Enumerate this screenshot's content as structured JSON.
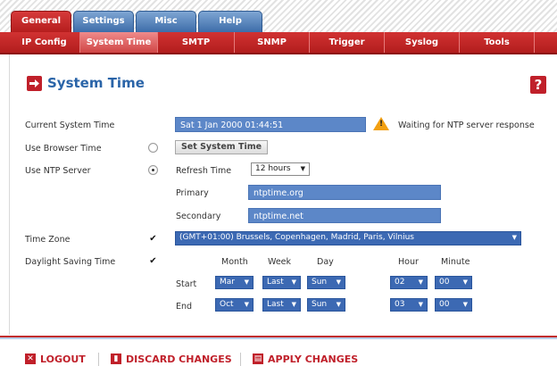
{
  "top_tabs": [
    "General",
    "Settings",
    "Misc",
    "Help"
  ],
  "sub_tabs": [
    "IP Config",
    "System Time",
    "SMTP",
    "SNMP",
    "Trigger",
    "Syslog",
    "Tools"
  ],
  "page_title": "System Time",
  "help_icon": "?",
  "labels": {
    "current_time": "Current System Time",
    "browser_time": "Use Browser Time",
    "ntp_server": "Use NTP Server",
    "time_zone": "Time Zone",
    "dst": "Daylight Saving Time"
  },
  "current_time_value": "Sat 1 Jan 2000 01:44:51",
  "warning_text": "Waiting for NTP server response",
  "set_time_button": "Set System Time",
  "ntp": {
    "refresh_label": "Refresh Time",
    "refresh_value": "12 hours",
    "primary_label": "Primary",
    "primary_value": "ntptime.org",
    "secondary_label": "Secondary",
    "secondary_value": "ntptime.net"
  },
  "time_zone_value": "(GMT+01:00) Brussels, Copenhagen, Madrid, Paris, Vilnius",
  "dst": {
    "col_headers": {
      "month": "Month",
      "week": "Week",
      "day": "Day",
      "hour": "Hour",
      "minute": "Minute"
    },
    "start": {
      "label": "Start",
      "month": "Mar",
      "week": "Last",
      "day": "Sun",
      "hour": "02",
      "minute": "00"
    },
    "end": {
      "label": "End",
      "month": "Oct",
      "week": "Last",
      "day": "Sun",
      "hour": "03",
      "minute": "00"
    }
  },
  "footer": {
    "logout": "LOGOUT",
    "discard": "DISCARD CHANGES",
    "apply": "APPLY CHANGES"
  },
  "state": {
    "use_browser_time": false,
    "use_ntp_server": true,
    "time_zone_checked": true,
    "dst_checked": true
  },
  "colors": {
    "accent_red": "#c0202a",
    "accent_blue": "#2a64a8",
    "field_blue": "#5c87c8"
  }
}
